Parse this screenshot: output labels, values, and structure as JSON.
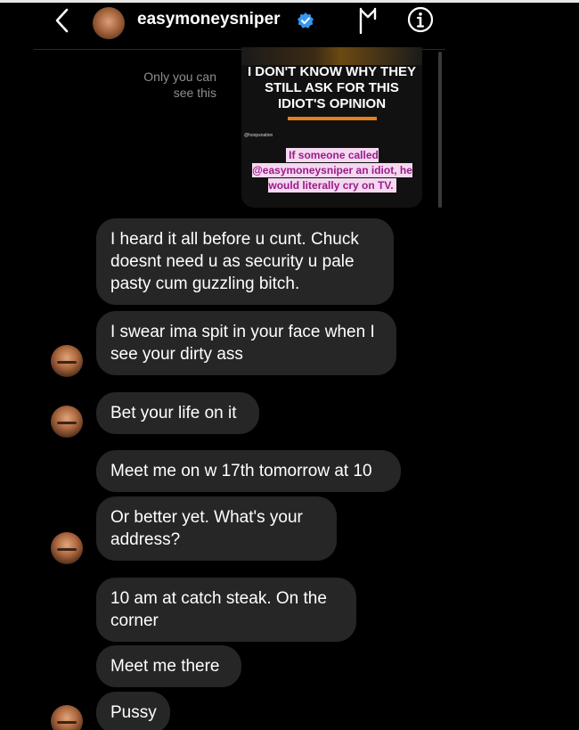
{
  "header": {
    "username": "easymoneysniper",
    "verified": true,
    "icons": [
      "chevron-left-icon",
      "verified-badge-icon",
      "flag-icon",
      "info-icon"
    ]
  },
  "story_reply": {
    "only_you_label": "Only you can see this",
    "headline": "I DON'T KNOW WHY THEY STILL ASK FOR THIS IDIOT'S OPINION",
    "handle": "@hoopsnation",
    "caption": "If someone called @easymoneysniper an idiot, he would literally cry on TV."
  },
  "messages": [
    {
      "text": "I heard it all before u cunt. Chuck doesnt need u as security u pale pasty cum guzzling bitch."
    },
    {
      "text": "I swear ima spit in your face when I see your dirty ass"
    },
    {
      "text": "Bet your life on it"
    },
    {
      "text": "Meet me on w 17th tomorrow at 10"
    },
    {
      "text": "Or better yet. What's your address?"
    },
    {
      "text": "10 am at catch steak. On the corner"
    },
    {
      "text": "Meet me there"
    },
    {
      "text": "Pussy"
    }
  ],
  "colors": {
    "background": "#000000",
    "bubble": "#262626",
    "verified": "#3897f0",
    "caption_bg": "#f4d8f0",
    "caption_text": "#9b1b8a"
  }
}
